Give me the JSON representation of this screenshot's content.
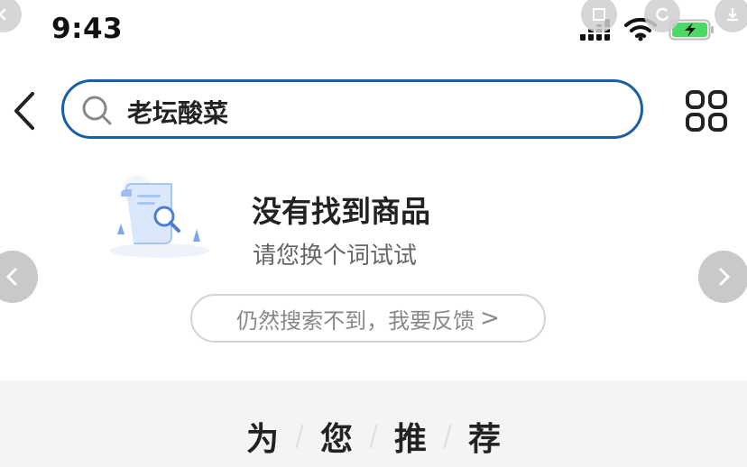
{
  "status_bar": {
    "time": "9:43"
  },
  "search": {
    "value": "老坛酸菜"
  },
  "empty_state": {
    "title": "没有找到商品",
    "subtitle": "请您换个词试试",
    "feedback_label": "仍然搜索不到，我要反馈",
    "feedback_chevron": ">"
  },
  "recommend": {
    "chars": [
      "为",
      "您",
      "推",
      "荐"
    ]
  },
  "icons": {
    "back": "chevron-left-icon",
    "search": "search-icon",
    "grid": "grid-icon",
    "signal": "cellular-signal-icon",
    "wifi": "wifi-icon",
    "battery": "battery-charging-icon"
  },
  "colors": {
    "search_border": "#1a5ea8",
    "battery_fill": "#4cd964",
    "recommend_bg": "#f4f4f4"
  }
}
